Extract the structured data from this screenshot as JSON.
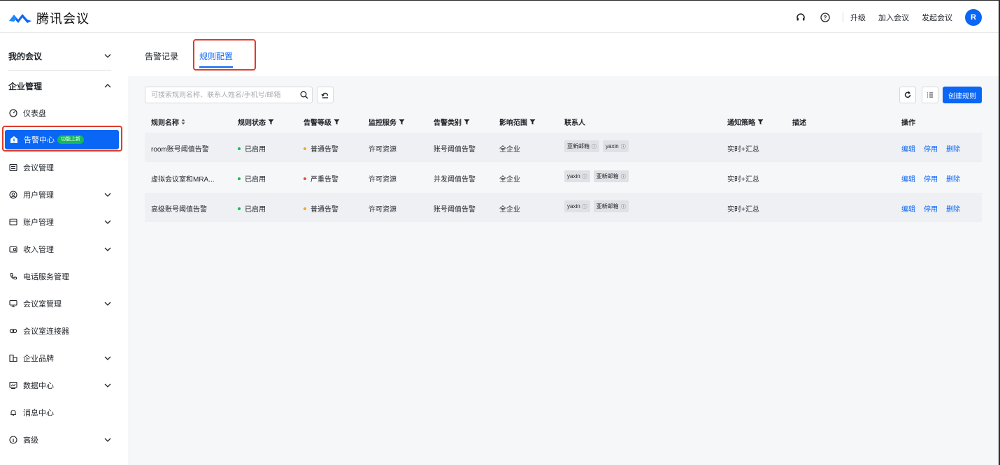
{
  "app": {
    "name": "腾讯会议"
  },
  "header": {
    "actions": [
      {
        "id": "upgrade",
        "label": "升级"
      },
      {
        "id": "join",
        "label": "加入会议"
      },
      {
        "id": "start",
        "label": "发起会议"
      }
    ],
    "avatar_initial": "R",
    "icons": [
      "headset-icon",
      "help-icon"
    ]
  },
  "sidebar": {
    "my_meetings": "我的会议",
    "enterprise": "企业管理",
    "items": [
      {
        "label": "仪表盘",
        "icon": "dashboard-icon",
        "expandable": false
      },
      {
        "label": "告警中心",
        "icon": "alert-house-icon",
        "expandable": false,
        "active": true,
        "badge": "功能上新"
      },
      {
        "label": "会议管理",
        "icon": "list-icon",
        "expandable": false
      },
      {
        "label": "用户管理",
        "icon": "user-icon",
        "expandable": true
      },
      {
        "label": "账户管理",
        "icon": "account-icon",
        "expandable": true
      },
      {
        "label": "收入管理",
        "icon": "wallet-icon",
        "expandable": true
      },
      {
        "label": "电话服务管理",
        "icon": "phone-icon",
        "expandable": false
      },
      {
        "label": "会议室管理",
        "icon": "room-icon",
        "expandable": true
      },
      {
        "label": "会议室连接器",
        "icon": "link-icon",
        "expandable": false
      },
      {
        "label": "企业品牌",
        "icon": "brand-icon",
        "expandable": true
      },
      {
        "label": "数据中心",
        "icon": "chart-icon",
        "expandable": true
      },
      {
        "label": "消息中心",
        "icon": "bell-icon",
        "expandable": false
      },
      {
        "label": "高级",
        "icon": "info-icon",
        "expandable": true
      }
    ]
  },
  "tabs": [
    {
      "label": "告警记录",
      "active": false
    },
    {
      "label": "规则配置",
      "active": true
    }
  ],
  "toolbar": {
    "search_placeholder": "可搜索规则名称、联系人姓名/手机号/邮箱",
    "create_label": "创建规则"
  },
  "table": {
    "columns": [
      "规则名称",
      "规则状态",
      "告警等级",
      "监控服务",
      "告警类别",
      "影响范围",
      "联系人",
      "通知策略",
      "描述",
      "操作"
    ],
    "rows": [
      {
        "name": "room账号阈值告警",
        "status": "已启用",
        "level": "普通告警",
        "level_color": "#f5a623",
        "service": "许可资源",
        "category": "账号阈值告警",
        "scope": "全企业",
        "contacts": [
          "亚新邮箱",
          "yaxin"
        ],
        "strategy": "实时+汇总",
        "desc": "",
        "ops": [
          "编辑",
          "停用",
          "删除"
        ]
      },
      {
        "name": "虚拟会议室和MRA...",
        "status": "已启用",
        "level": "严重告警",
        "level_color": "#f04b3f",
        "service": "许可资源",
        "category": "并发阈值告警",
        "scope": "全企业",
        "contacts": [
          "yaxin",
          "亚新邮箱"
        ],
        "strategy": "实时+汇总",
        "desc": "",
        "ops": [
          "编辑",
          "停用",
          "删除"
        ]
      },
      {
        "name": "高级账号阈值告警",
        "status": "已启用",
        "level": "普通告警",
        "level_color": "#f5a623",
        "service": "许可资源",
        "category": "账号阈值告警",
        "scope": "全企业",
        "contacts": [
          "yaxin",
          "亚新邮箱"
        ],
        "strategy": "实时+汇总",
        "desc": "",
        "ops": [
          "编辑",
          "停用",
          "删除"
        ]
      }
    ]
  },
  "colors": {
    "accent": "#0a66f5",
    "success": "#16b85a",
    "highlight": "#e03a2b"
  }
}
